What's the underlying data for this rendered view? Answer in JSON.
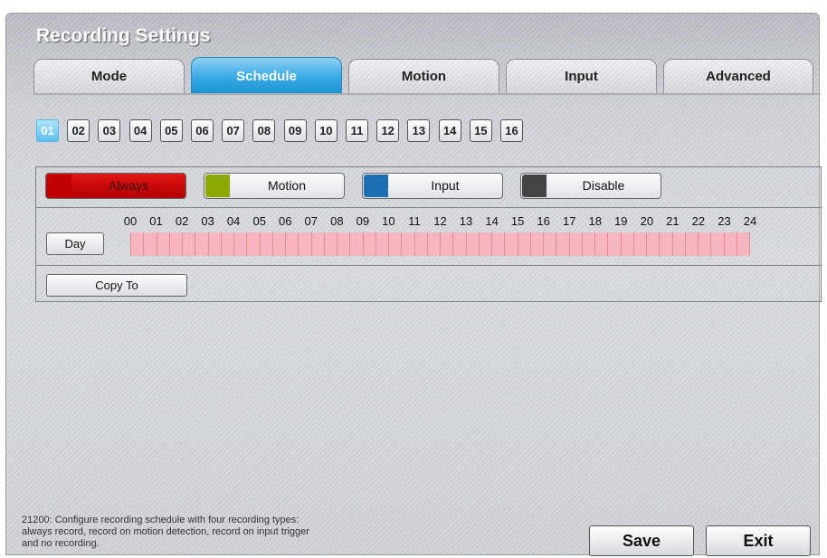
{
  "window": {
    "title": "Recording Settings"
  },
  "tabs": [
    {
      "label": "Mode"
    },
    {
      "label": "Schedule",
      "active": true
    },
    {
      "label": "Motion"
    },
    {
      "label": "Input"
    },
    {
      "label": "Advanced"
    }
  ],
  "channels": [
    "01",
    "02",
    "03",
    "04",
    "05",
    "06",
    "07",
    "08",
    "09",
    "10",
    "11",
    "12",
    "13",
    "14",
    "15",
    "16"
  ],
  "selected_channel": "01",
  "record_types": [
    {
      "label": "Always",
      "color": "#c00000",
      "selected": true
    },
    {
      "label": "Motion",
      "color": "#8aa800"
    },
    {
      "label": "Input",
      "color": "#1d6fb3"
    },
    {
      "label": "Disable",
      "color": "#444444"
    }
  ],
  "schedule": {
    "hours": [
      "00",
      "01",
      "02",
      "03",
      "04",
      "05",
      "06",
      "07",
      "08",
      "09",
      "10",
      "11",
      "12",
      "13",
      "14",
      "15",
      "16",
      "17",
      "18",
      "19",
      "20",
      "21",
      "22",
      "23",
      "24"
    ],
    "day_label": "Day",
    "cell_count": 48,
    "cell_color": "#f7b6bf",
    "copy_label": "Copy To"
  },
  "help_text": "21200: Configure recording schedule with four recording types:\nalways record, record on motion detection, record on input trigger\nand no recording.",
  "help_lines": [
    "21200: Configure recording schedule with four recording types:",
    "always record, record on motion detection, record on input trigger",
    "and no recording."
  ],
  "footer": {
    "save_label": "Save",
    "exit_label": "Exit"
  }
}
